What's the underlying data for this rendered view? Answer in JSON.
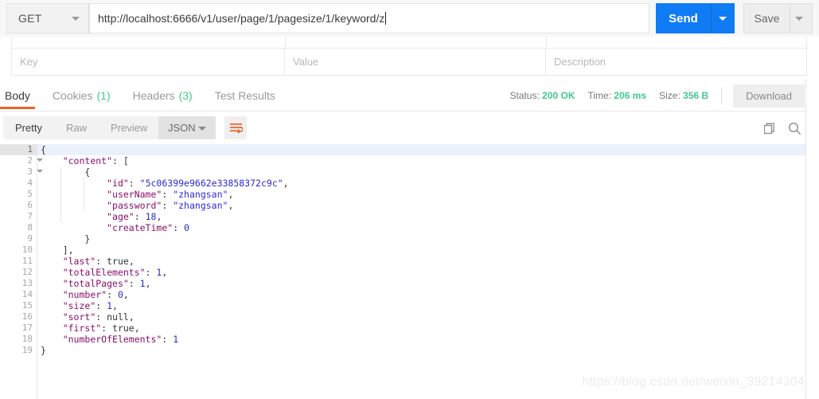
{
  "request": {
    "method": "GET",
    "method_caret_icon": "chevron-down-icon",
    "url": "http://localhost:6666/v1/user/page/1/pagesize/1/keyword/z",
    "send_label": "Send",
    "send_caret_icon": "chevron-down-icon",
    "save_label": "Save",
    "save_caret_icon": "chevron-down-icon"
  },
  "params_table": {
    "columns": [
      "Key",
      "Value",
      "Description"
    ]
  },
  "response": {
    "tabs": [
      {
        "label": "Body",
        "count": "",
        "active": true
      },
      {
        "label": "Cookies",
        "count": "(1)",
        "active": false
      },
      {
        "label": "Headers",
        "count": "(3)",
        "active": false
      },
      {
        "label": "Test Results",
        "count": "",
        "active": false
      }
    ],
    "status_label": "Status:",
    "status_value": "200 OK",
    "time_label": "Time:",
    "time_value": "206 ms",
    "size_label": "Size:",
    "size_value": "356 B",
    "download_label": "Download",
    "accent_color": "#ec6228",
    "status_color": "#41c98e"
  },
  "viewer": {
    "modes": [
      {
        "label": "Pretty",
        "active": true
      },
      {
        "label": "Raw",
        "active": false
      },
      {
        "label": "Preview",
        "active": false
      }
    ],
    "format_label": "JSON",
    "format_caret_icon": "chevron-down-icon",
    "wrap_icon": "word-wrap-icon",
    "copy_icon": "copy-icon",
    "search_icon": "search-icon"
  },
  "code": {
    "active_line": 1,
    "fold_lines": [
      1,
      2,
      3
    ],
    "lines": [
      {
        "n": 1,
        "indent": 0,
        "tokens": [
          {
            "t": "punc",
            "v": "{"
          }
        ]
      },
      {
        "n": 2,
        "indent": 1,
        "tokens": [
          {
            "t": "key",
            "v": "\"content\""
          },
          {
            "t": "punc",
            "v": ": ["
          }
        ]
      },
      {
        "n": 3,
        "indent": 2,
        "tokens": [
          {
            "t": "punc",
            "v": "{"
          }
        ]
      },
      {
        "n": 4,
        "indent": 3,
        "tokens": [
          {
            "t": "key",
            "v": "\"id\""
          },
          {
            "t": "punc",
            "v": ": "
          },
          {
            "t": "str",
            "v": "\"5c06399e9662e33858372c9c\""
          },
          {
            "t": "punc",
            "v": ","
          }
        ]
      },
      {
        "n": 5,
        "indent": 3,
        "tokens": [
          {
            "t": "key",
            "v": "\"userName\""
          },
          {
            "t": "punc",
            "v": ": "
          },
          {
            "t": "str",
            "v": "\"zhangsan\""
          },
          {
            "t": "punc",
            "v": ","
          }
        ]
      },
      {
        "n": 6,
        "indent": 3,
        "tokens": [
          {
            "t": "key",
            "v": "\"password\""
          },
          {
            "t": "punc",
            "v": ": "
          },
          {
            "t": "str",
            "v": "\"zhangsan\""
          },
          {
            "t": "punc",
            "v": ","
          }
        ]
      },
      {
        "n": 7,
        "indent": 3,
        "tokens": [
          {
            "t": "key",
            "v": "\"age\""
          },
          {
            "t": "punc",
            "v": ": "
          },
          {
            "t": "num",
            "v": "18"
          },
          {
            "t": "punc",
            "v": ","
          }
        ]
      },
      {
        "n": 8,
        "indent": 3,
        "tokens": [
          {
            "t": "key",
            "v": "\"createTime\""
          },
          {
            "t": "punc",
            "v": ": "
          },
          {
            "t": "num",
            "v": "0"
          }
        ]
      },
      {
        "n": 9,
        "indent": 2,
        "tokens": [
          {
            "t": "punc",
            "v": "}"
          }
        ]
      },
      {
        "n": 10,
        "indent": 1,
        "tokens": [
          {
            "t": "punc",
            "v": "],"
          }
        ]
      },
      {
        "n": 11,
        "indent": 1,
        "tokens": [
          {
            "t": "key",
            "v": "\"last\""
          },
          {
            "t": "punc",
            "v": ": "
          },
          {
            "t": "kw",
            "v": "true"
          },
          {
            "t": "punc",
            "v": ","
          }
        ]
      },
      {
        "n": 12,
        "indent": 1,
        "tokens": [
          {
            "t": "key",
            "v": "\"totalElements\""
          },
          {
            "t": "punc",
            "v": ": "
          },
          {
            "t": "num",
            "v": "1"
          },
          {
            "t": "punc",
            "v": ","
          }
        ]
      },
      {
        "n": 13,
        "indent": 1,
        "tokens": [
          {
            "t": "key",
            "v": "\"totalPages\""
          },
          {
            "t": "punc",
            "v": ": "
          },
          {
            "t": "num",
            "v": "1"
          },
          {
            "t": "punc",
            "v": ","
          }
        ]
      },
      {
        "n": 14,
        "indent": 1,
        "tokens": [
          {
            "t": "key",
            "v": "\"number\""
          },
          {
            "t": "punc",
            "v": ": "
          },
          {
            "t": "num",
            "v": "0"
          },
          {
            "t": "punc",
            "v": ","
          }
        ]
      },
      {
        "n": 15,
        "indent": 1,
        "tokens": [
          {
            "t": "key",
            "v": "\"size\""
          },
          {
            "t": "punc",
            "v": ": "
          },
          {
            "t": "num",
            "v": "1"
          },
          {
            "t": "punc",
            "v": ","
          }
        ]
      },
      {
        "n": 16,
        "indent": 1,
        "tokens": [
          {
            "t": "key",
            "v": "\"sort\""
          },
          {
            "t": "punc",
            "v": ": "
          },
          {
            "t": "kw",
            "v": "null"
          },
          {
            "t": "punc",
            "v": ","
          }
        ]
      },
      {
        "n": 17,
        "indent": 1,
        "tokens": [
          {
            "t": "key",
            "v": "\"first\""
          },
          {
            "t": "punc",
            "v": ": "
          },
          {
            "t": "kw",
            "v": "true"
          },
          {
            "t": "punc",
            "v": ","
          }
        ]
      },
      {
        "n": 18,
        "indent": 1,
        "tokens": [
          {
            "t": "key",
            "v": "\"numberOfElements\""
          },
          {
            "t": "punc",
            "v": ": "
          },
          {
            "t": "num",
            "v": "1"
          }
        ]
      },
      {
        "n": 19,
        "indent": 0,
        "tokens": [
          {
            "t": "punc",
            "v": "}"
          }
        ]
      }
    ]
  },
  "watermark": "https://blog.csdn.net/weixin_39214304"
}
